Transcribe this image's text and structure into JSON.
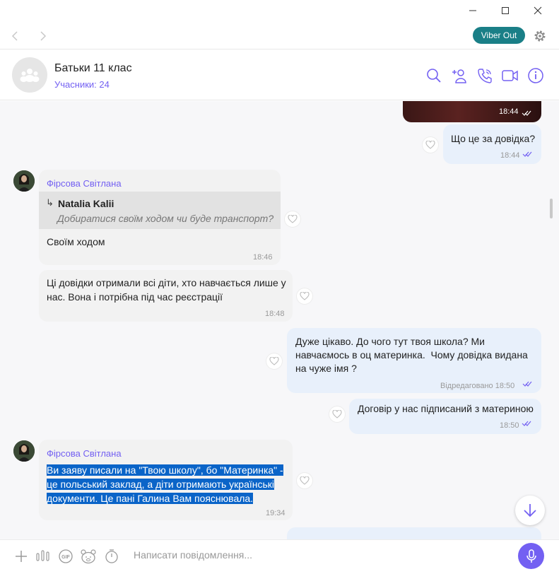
{
  "window": {
    "minimize_icon": "minimize-icon",
    "maximize_icon": "maximize-icon",
    "close_icon": "close-icon"
  },
  "navbar": {
    "viber_out_label": "Viber Out"
  },
  "header": {
    "title": "Батьки 11 клас",
    "members": "Учасники: 24"
  },
  "messages": {
    "m1_time": "18:44",
    "m2_text": "Що це за довідка?",
    "m2_time": "18:44",
    "m3_sender": "Фірсова Світлана",
    "m3_reply_name": "Natalia Kalii",
    "m3_reply_text": "Добиратися своїм ходом чи буде транспорт?",
    "m3_text": "Своїм ходом",
    "m3_time": "18:46",
    "m4_line1": "Ці довідки отримали всі діти, хто навчається лише у",
    "m4_line2": "нас. Вона і потрібна під час реєстрації",
    "m4_time": "18:48",
    "m5_line1": "Дуже цікаво. До чого тут твоя школа? Ми",
    "m5_line2": "навчаємось в оц материнка.  Чому довідка видана",
    "m5_line3": "на чуже імя ?",
    "m5_time": "Відредаговано 18:50",
    "m6_text": "Договір у нас підписаний з материною",
    "m6_time": "18:50",
    "m7_sender": "Фірсова Світлана",
    "m7_line1": "Ви заяву писали на \"Твою школу\", бо \"Материнка\" -",
    "m7_line2": "це польський заклад, а діти отримають українські",
    "m7_line3": "документи. Це пані Галина Вам пояснювала.",
    "m7_time": "19:34"
  },
  "composer": {
    "placeholder": "Написати повідомлення..."
  },
  "colors": {
    "accent": "#7360f2",
    "viber_out": "#1a7f87",
    "selection": "#0a64c8"
  }
}
